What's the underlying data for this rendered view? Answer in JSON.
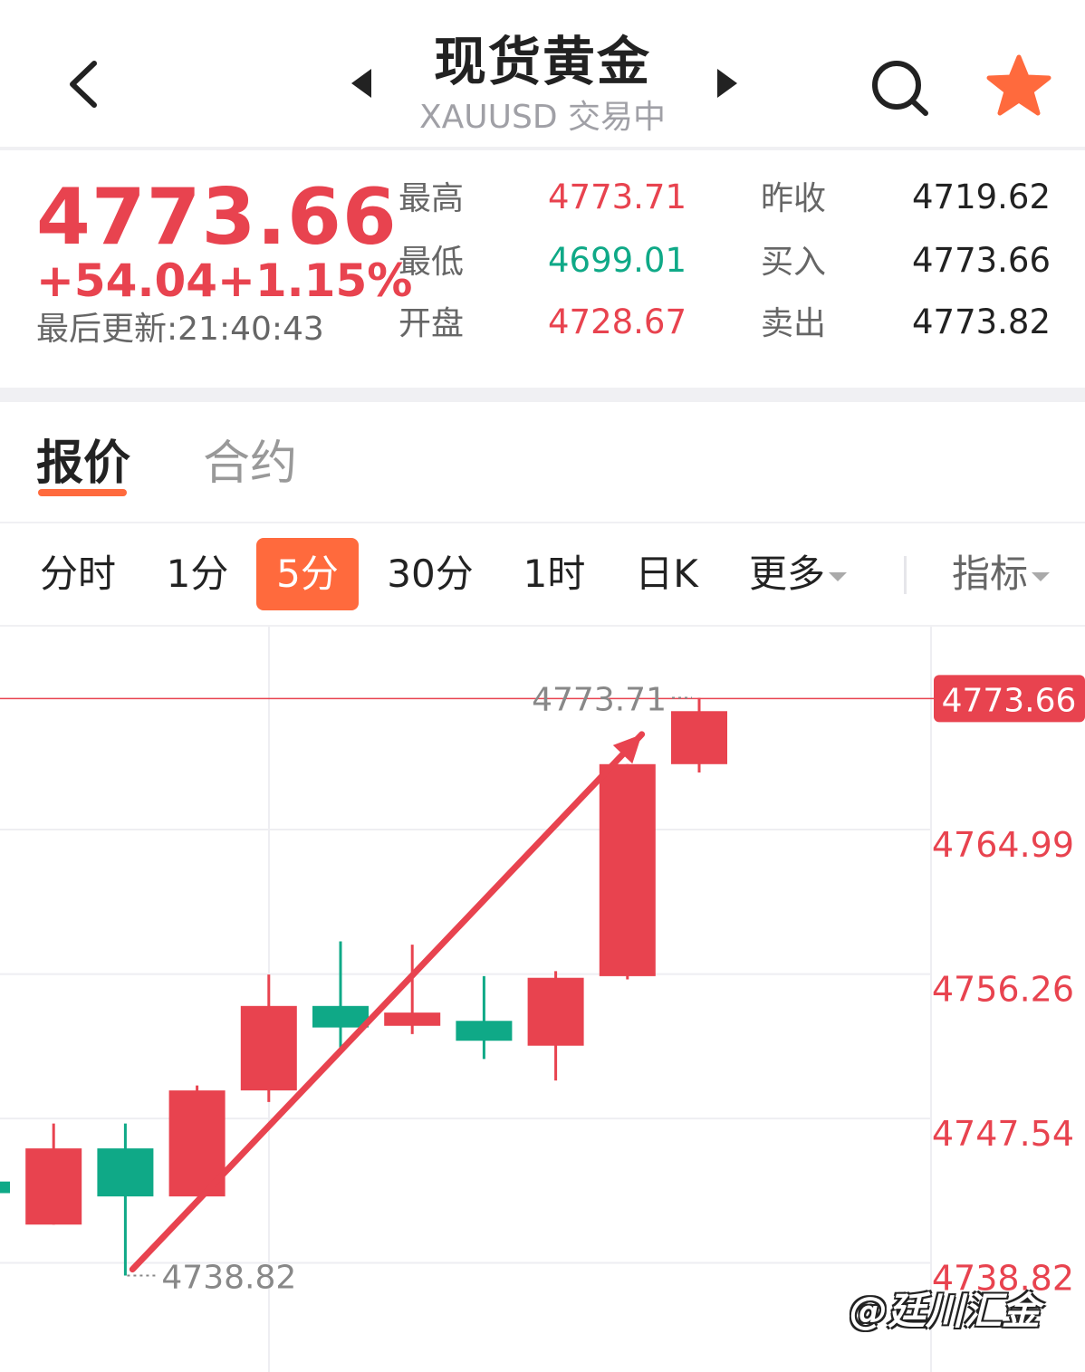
{
  "header": {
    "title": "现货黄金",
    "subtitle": "XAUUSD 交易中",
    "icons": {
      "back": "chevron-left-icon",
      "prev": "triangle-left-icon",
      "next": "triangle-right-icon",
      "search": "search-icon",
      "favorite": "star-icon"
    },
    "favorite_color": "#ff6a3d"
  },
  "quote": {
    "price": "4773.66",
    "change": "+54.04",
    "change_pct": "+1.15%",
    "last_update": "最后更新:21:40:43",
    "stats": [
      {
        "label": "最高",
        "value": "4773.71",
        "color": "#e8434f"
      },
      {
        "label": "最低",
        "value": "4699.01",
        "color": "#0fa987"
      },
      {
        "label": "开盘",
        "value": "4728.67",
        "color": "#e8434f"
      },
      {
        "label": "昨收",
        "value": "4719.62",
        "color": "#222222"
      },
      {
        "label": "买入",
        "value": "4773.66",
        "color": "#222222"
      },
      {
        "label": "卖出",
        "value": "4773.82",
        "color": "#222222"
      }
    ]
  },
  "tabs": [
    {
      "label": "报价",
      "active": true
    },
    {
      "label": "合约",
      "active": false
    }
  ],
  "periods": [
    {
      "label": "分时",
      "active": false
    },
    {
      "label": "1分",
      "active": false
    },
    {
      "label": "5分",
      "active": true
    },
    {
      "label": "30分",
      "active": false
    },
    {
      "label": "1时",
      "active": false
    },
    {
      "label": "日K",
      "active": false
    },
    {
      "label": "更多",
      "active": false,
      "dropdown": true
    }
  ],
  "indicator": {
    "label": "指标",
    "dropdown": true
  },
  "colors": {
    "up": "#e8434f",
    "down": "#0fa987",
    "accent": "#ff6a3d",
    "grid": "#eeeef2"
  },
  "chart_data": {
    "type": "candlestick",
    "y_axis_labels": [
      "4764.99",
      "4756.26",
      "4747.54",
      "4738.82"
    ],
    "ylim": [
      4733.0,
      4778.0
    ],
    "current_price_tag": "4773.66",
    "current_price_line": 4773.66,
    "max_label": "4773.71",
    "min_label": "4738.82",
    "candles": [
      {
        "open": 4744.5,
        "close": 4743.8,
        "high": 4744.6,
        "low": 4743.7
      },
      {
        "open": 4741.9,
        "close": 4746.5,
        "high": 4748.0,
        "low": 4741.9
      },
      {
        "open": 4746.5,
        "close": 4743.6,
        "high": 4748.0,
        "low": 4738.82
      },
      {
        "open": 4743.6,
        "close": 4750.0,
        "high": 4750.3,
        "low": 4743.6
      },
      {
        "open": 4750.0,
        "close": 4755.1,
        "high": 4757.0,
        "low": 4749.3
      },
      {
        "open": 4755.1,
        "close": 4753.8,
        "high": 4759.0,
        "low": 4752.4
      },
      {
        "open": 4753.9,
        "close": 4754.7,
        "high": 4758.8,
        "low": 4753.4
      },
      {
        "open": 4754.2,
        "close": 4753.0,
        "high": 4756.9,
        "low": 4751.9
      },
      {
        "open": 4752.7,
        "close": 4756.8,
        "high": 4757.2,
        "low": 4750.6
      },
      {
        "open": 4756.9,
        "close": 4769.7,
        "high": 4769.7,
        "low": 4756.7
      },
      {
        "open": 4769.7,
        "close": 4772.9,
        "high": 4773.71,
        "low": 4769.2
      }
    ],
    "arrow": {
      "from_candle": 2.1,
      "from_price": 4739.2,
      "to_candle": 9.2,
      "to_price": 4771.5,
      "color": "#e8434f"
    }
  },
  "watermark": "@廷川汇金"
}
